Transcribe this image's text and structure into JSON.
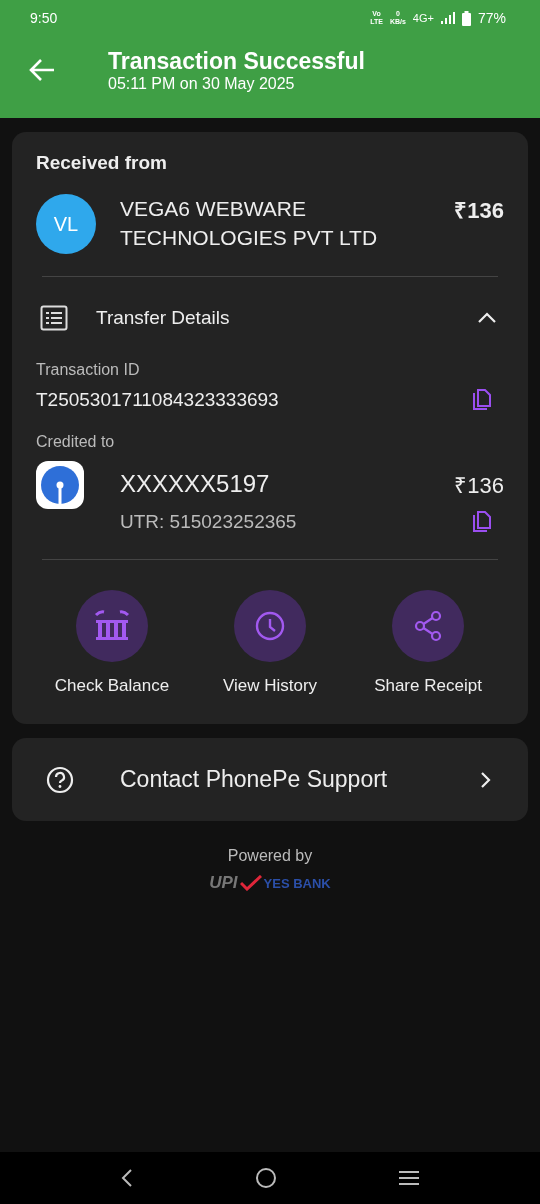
{
  "status_bar": {
    "time": "9:50",
    "volte_top": "Vo",
    "volte_bottom": "LTE",
    "speed_value": "0",
    "speed_unit": "KB/s",
    "network": "4G+",
    "battery": "77%"
  },
  "header": {
    "title": "Transaction Successful",
    "subtitle": "05:11 PM on 30 May 2025"
  },
  "received": {
    "heading": "Received from",
    "initials": "VL",
    "name": "VEGA6 WEBWARE TECHNOLOGIES PVT LTD",
    "amount": "₹136"
  },
  "transfer_details": {
    "title": "Transfer Details",
    "expanded": true,
    "transaction_id_label": "Transaction ID",
    "transaction_id": "T2505301711084323333693",
    "credited_label": "Credited to",
    "account": "XXXXXX5197",
    "account_amount": "₹136",
    "utr": "UTR: 515023252365"
  },
  "actions": [
    {
      "kind": "bank",
      "label": "Check Balance"
    },
    {
      "kind": "clock",
      "label": "View History"
    },
    {
      "kind": "share",
      "label": "Share Receipt"
    }
  ],
  "support": {
    "label": "Contact PhonePe Support"
  },
  "footer": {
    "powered_by": "Powered by",
    "upi": "UPI",
    "bank": "YES BANK"
  }
}
